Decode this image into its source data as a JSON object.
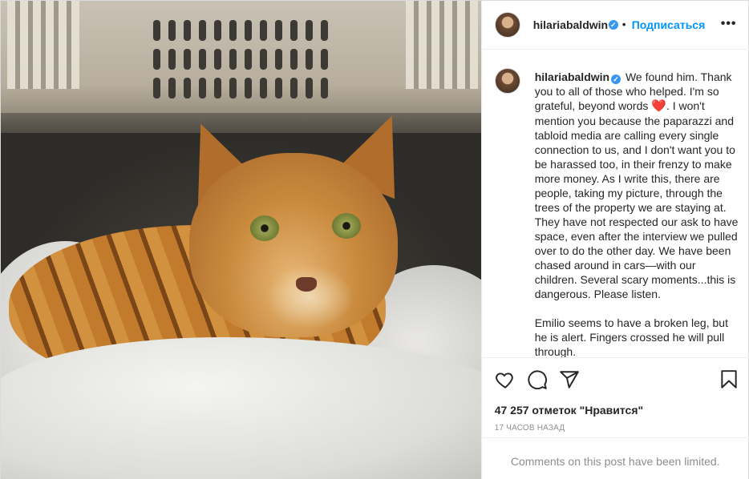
{
  "post": {
    "image_alt": "Bengal cat lying in a pet carrier on a white towel"
  },
  "header": {
    "username": "hilariabaldwin",
    "separator": "•",
    "follow_label": "Подписаться",
    "more_label": "•••"
  },
  "caption": {
    "username": "hilariabaldwin",
    "text_1": "We found him. Thank you to all of those who helped. I'm so grateful, beyond words",
    "emoji": "❤️",
    "text_2": ". I won't mention you because the paparazzi and tabloid media are calling every single connection to us, and I don't want you to be harassed too, in their frenzy to make more money. As I write this, there are people, taking my picture, through the trees of the property we are staying at. They have not respected our ask to have space, even after the interview we pulled over to do the other day. We have been chased around in cars—with our children. Several scary moments...this is dangerous. Please listen.",
    "paragraph_2": "Emilio seems to have a broken leg, but he is alert. Fingers crossed he will pull through."
  },
  "actions": {
    "icons": [
      "heart-icon",
      "comment-icon",
      "share-icon",
      "bookmark-icon"
    ]
  },
  "likes": "47 257 отметок \"Нравится\"",
  "timestamp": "17 ЧАСОВ НАЗАД",
  "comments_limited": "Comments on this post have been limited.",
  "colors": {
    "link": "#0095f6",
    "verified": "#3897f0",
    "muted": "#8e8e8e",
    "text": "#262626"
  }
}
